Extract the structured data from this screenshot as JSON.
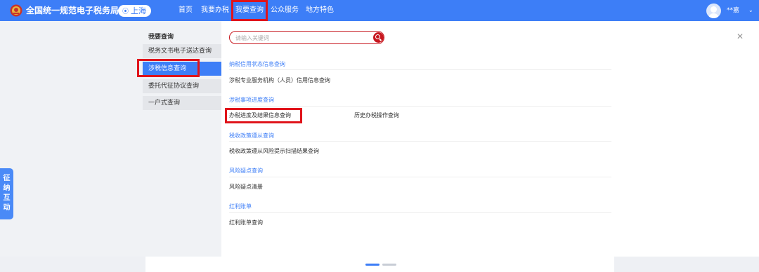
{
  "header": {
    "site_title": "全国统一规范电子税务局",
    "region": "上海",
    "nav": [
      {
        "label": "首页"
      },
      {
        "label": "我要办税"
      },
      {
        "label": "我要查询"
      },
      {
        "label": "公众服务"
      },
      {
        "label": "地方特色"
      }
    ],
    "user_name": "**嘉"
  },
  "sidebar": {
    "title": "我要查询",
    "items": [
      {
        "label": "税务文书电子送达查询"
      },
      {
        "label": "涉税信息查询"
      },
      {
        "label": "委托代征协议查询"
      },
      {
        "label": "一户式查询"
      }
    ]
  },
  "search": {
    "placeholder": "请输入关键词",
    "value": ""
  },
  "sections": [
    {
      "title": "纳税信用状态信息查询",
      "links": [
        "涉税专业服务机构（人员）信用信息查询"
      ]
    },
    {
      "title": "涉税事项进度查询",
      "links": [
        "办税进度及结果信息查询",
        "历史办税操作查询"
      ]
    },
    {
      "title": "税收政策遵从查询",
      "links": [
        "税收政策遵从风险提示扫描结果查询"
      ]
    },
    {
      "title": "风险疑点查询",
      "links": [
        "风险疑点清册"
      ]
    },
    {
      "title": "红利账单",
      "links": [
        "红利账单查询"
      ]
    }
  ],
  "floating_tab": {
    "chars": [
      "征",
      "纳",
      "互",
      "动"
    ]
  },
  "colors": {
    "brand": "#3d7ef7",
    "highlight": "#e0141b",
    "search_accent": "#c7171f"
  }
}
